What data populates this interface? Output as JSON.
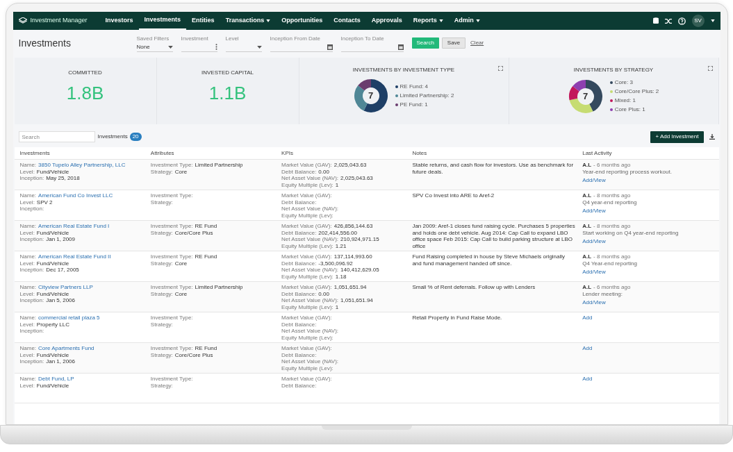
{
  "app": {
    "brand": "Investment Manager",
    "avatar": "SV"
  },
  "nav": [
    {
      "label": "Investors",
      "selected": false,
      "dropdown": false
    },
    {
      "label": "Investments",
      "selected": true,
      "dropdown": false
    },
    {
      "label": "Entities",
      "selected": false,
      "dropdown": false
    },
    {
      "label": "Transactions",
      "selected": false,
      "dropdown": true
    },
    {
      "label": "Opportunities",
      "selected": false,
      "dropdown": false
    },
    {
      "label": "Contacts",
      "selected": false,
      "dropdown": false
    },
    {
      "label": "Approvals",
      "selected": false,
      "dropdown": false
    },
    {
      "label": "Reports",
      "selected": false,
      "dropdown": true
    },
    {
      "label": "Admin",
      "selected": false,
      "dropdown": true
    }
  ],
  "page_title": "Investments",
  "filters": [
    {
      "label": "Saved Filters",
      "value": "None",
      "kind": "select"
    },
    {
      "label": "Investment",
      "kind": "menu"
    },
    {
      "label": "Level",
      "kind": "select"
    },
    {
      "label": "Inception From Date",
      "kind": "date"
    },
    {
      "label": "Inception To Date",
      "kind": "date"
    }
  ],
  "actions": {
    "search": "Search",
    "save": "Save",
    "clear": "Clear"
  },
  "stats": [
    {
      "label": "COMMITTED",
      "value": "1.8B"
    },
    {
      "label": "INVESTED CAPITAL",
      "value": "1.1B"
    }
  ],
  "charts": [
    {
      "title": "INVESTMENTS BY INVESTMENT TYPE",
      "total": "7",
      "slices": [
        {
          "color": "#1e3f66"
        },
        {
          "color": "#4f8796"
        },
        {
          "color": "#6a3d6e"
        }
      ],
      "chart_data": {
        "type": "donut",
        "categories": [
          "RE Fund: 4",
          "Limited Partnership: 2",
          "PE Fund: 1"
        ],
        "values": [
          4,
          2,
          1
        ],
        "legend": "right"
      }
    },
    {
      "title": "INVESTMENTS BY STRATEGY",
      "total": "7",
      "slices": [
        {
          "color": "#34495e"
        },
        {
          "color": "#c6dc72"
        },
        {
          "color": "#c2185b"
        },
        {
          "color": "#8e3fb0"
        }
      ],
      "chart_data": {
        "type": "donut",
        "categories": [
          "Core: 3",
          "Core/Core Plus: 2",
          "Mixed: 1",
          "Core Plus: 1"
        ],
        "values": [
          3,
          2,
          1,
          1
        ],
        "legend": "right"
      }
    }
  ],
  "table_toolbar": {
    "search_placeholder": "Search",
    "tab_label": "Investments",
    "count": "20",
    "add_button": "+ Add Investment"
  },
  "columns": [
    "Investments",
    "Attributes",
    "KPIs",
    "Notes",
    "Last Activity"
  ],
  "rows": [
    {
      "investment": [
        {
          "label": "Name:",
          "value": "3850 Tupelo Alley Partnership, LLC"
        },
        {
          "label": "Level:",
          "value": "Fund/Vehicle"
        },
        {
          "label": "Inception:",
          "value": "May 25, 2018"
        }
      ],
      "attributes": [
        {
          "label": "Investment Type:",
          "value": "Limited Partnership"
        },
        {
          "label": "Strategy:",
          "value": "Core"
        }
      ],
      "kpis": [
        {
          "label": "Market Value (GAV):",
          "value": "2,025,043.63"
        },
        {
          "label": "Debt Balance:",
          "value": "0.00"
        },
        {
          "label": "Net Asset Value (NAV):",
          "value": "2,025,043.63"
        },
        {
          "label": "Equity Multiple (Lev):",
          "value": "1"
        }
      ],
      "notes": "Stable returns, and cash flow for investors. Use as benchmark for future deals.",
      "activity": {
        "user": "A.L",
        "time": "- 6 months ago",
        "note": "Year-end reporting process workout."
      },
      "action": "Add/View"
    },
    {
      "investment": [
        {
          "label": "Name:",
          "value": "American Fund Co Invest LLC"
        },
        {
          "label": "Level:",
          "value": "SPV 2"
        },
        {
          "label": "Inception:"
        }
      ],
      "attributes": [
        {
          "label": "Investment Type:"
        },
        {
          "label": "Strategy:"
        }
      ],
      "kpis": [
        {
          "label": "Market Value (GAV):"
        },
        {
          "label": "Debt Balance:"
        },
        {
          "label": "Net Asset Value (NAV):"
        },
        {
          "label": "Equity Multiple (Lev):"
        }
      ],
      "notes": "SPV Co Invest into ARE to Aref-2",
      "activity": {
        "user": "A.L",
        "time": "- 8 months ago",
        "note": "Q4 year-end reporting"
      },
      "action": "Add/View"
    },
    {
      "investment": [
        {
          "label": "Name:",
          "value": "American Real Estate Fund I"
        },
        {
          "label": "Level:",
          "value": "Fund/Vehicle"
        },
        {
          "label": "Inception:",
          "value": "Jan 1, 2009"
        }
      ],
      "attributes": [
        {
          "label": "Investment Type:",
          "value": "RE Fund"
        },
        {
          "label": "Strategy:",
          "value": "Core/Core Plus"
        }
      ],
      "kpis": [
        {
          "label": "Market Value (GAV):",
          "value": "426,856,144.63"
        },
        {
          "label": "Debt Balance:",
          "value": "202,414,556.00"
        },
        {
          "label": "Net Asset Value (NAV):",
          "value": "210,924,971.15"
        },
        {
          "label": "Equity Multiple (Lev):",
          "value": "1.21"
        }
      ],
      "notes": "Jan 2009: Aref-1 closes fund raising cycle. Purchases 5 properties and holds one debt vehicle. Aug 2014: Cap Call to expand LBO office space Feb 2015: Cap Call to build parking structure at LBO office",
      "activity": {
        "user": "A.L",
        "time": "- 8 months ago",
        "note": "Start working on Q4 year-end reporting"
      },
      "action": "Add/View"
    },
    {
      "investment": [
        {
          "label": "Name:",
          "value": "American Real Estate Fund II"
        },
        {
          "label": "Level:",
          "value": "Fund/Vehicle"
        },
        {
          "label": "Inception:",
          "value": "Dec 17, 2005"
        }
      ],
      "attributes": [
        {
          "label": "Investment Type:",
          "value": "RE Fund"
        },
        {
          "label": "Strategy:",
          "value": "Core"
        }
      ],
      "kpis": [
        {
          "label": "Market Value (GAV):",
          "value": "137,114,993.60"
        },
        {
          "label": "Debt Balance:",
          "value": "-3,500,096.92"
        },
        {
          "label": "Net Asset Value (NAV):",
          "value": "140,412,629.05"
        },
        {
          "label": "Equity Multiple (Lev):",
          "value": "1.18"
        }
      ],
      "notes": "Fund Raising completed in house by Steve Michaels originally and fund management handed off since.",
      "activity": {
        "user": "A.L",
        "time": "- 8 months ago",
        "note": "Q4 Year-end reporting"
      },
      "action": "Add/View"
    },
    {
      "investment": [
        {
          "label": "Name:",
          "value": "Cityview Partners LLP"
        },
        {
          "label": "Level:",
          "value": "Fund/Vehicle"
        },
        {
          "label": "Inception:",
          "value": "Jan 5, 2006"
        }
      ],
      "attributes": [
        {
          "label": "Investment Type:",
          "value": "Limited Partnership"
        },
        {
          "label": "Strategy:",
          "value": "Core"
        }
      ],
      "kpis": [
        {
          "label": "Market Value (GAV):",
          "value": "1,051,651.94"
        },
        {
          "label": "Debt Balance:",
          "value": "0.00"
        },
        {
          "label": "Net Asset Value (NAV):",
          "value": "1,051,651.94"
        },
        {
          "label": "Equity Multiple (Lev):",
          "value": "1"
        }
      ],
      "notes": "Small % of Rent deferrals. Follow up with Lenders",
      "activity": {
        "user": "A.L",
        "time": "- 6 months ago",
        "note": "Lender meeting:"
      },
      "action": "Add/View"
    },
    {
      "investment": [
        {
          "label": "Name:",
          "value": "commercial retail plaza 5"
        },
        {
          "label": "Level:",
          "value": "Property LLC"
        },
        {
          "label": "Inception:"
        }
      ],
      "attributes": [
        {
          "label": "Investment Type:"
        },
        {
          "label": "Strategy:"
        }
      ],
      "kpis": [
        {
          "label": "Market Value (GAV):"
        },
        {
          "label": "Debt Balance:"
        },
        {
          "label": "Net Asset Value (NAV):"
        },
        {
          "label": "Equity Multiple (Lev):"
        }
      ],
      "notes": "Retail Property in Fund Raise Mode.",
      "action": "Add"
    },
    {
      "investment": [
        {
          "label": "Name:",
          "value": "Core Apartments Fund"
        },
        {
          "label": "Level:",
          "value": "Fund/Vehicle"
        },
        {
          "label": "Inception:",
          "value": "Jan 1, 2006"
        }
      ],
      "attributes": [
        {
          "label": "Investment Type:",
          "value": "RE Fund"
        },
        {
          "label": "Strategy:",
          "value": "Core/Core Plus"
        }
      ],
      "kpis": [
        {
          "label": "Market Value (GAV):"
        },
        {
          "label": "Debt Balance:"
        },
        {
          "label": "Net Asset Value (NAV):"
        },
        {
          "label": "Equity Multiple (Lev):"
        }
      ],
      "action": "Add"
    },
    {
      "investment": [
        {
          "label": "Name:",
          "value": "Debt Fund, LP"
        },
        {
          "label": "Level:",
          "value": "Fund/Vehicle"
        }
      ],
      "attributes": [
        {
          "label": "Investment Type:"
        },
        {
          "label": "Strategy:"
        }
      ],
      "kpis": [
        {
          "label": "Market Value (GAV):"
        },
        {
          "label": "Debt Balance:"
        }
      ],
      "action": "Add"
    }
  ]
}
